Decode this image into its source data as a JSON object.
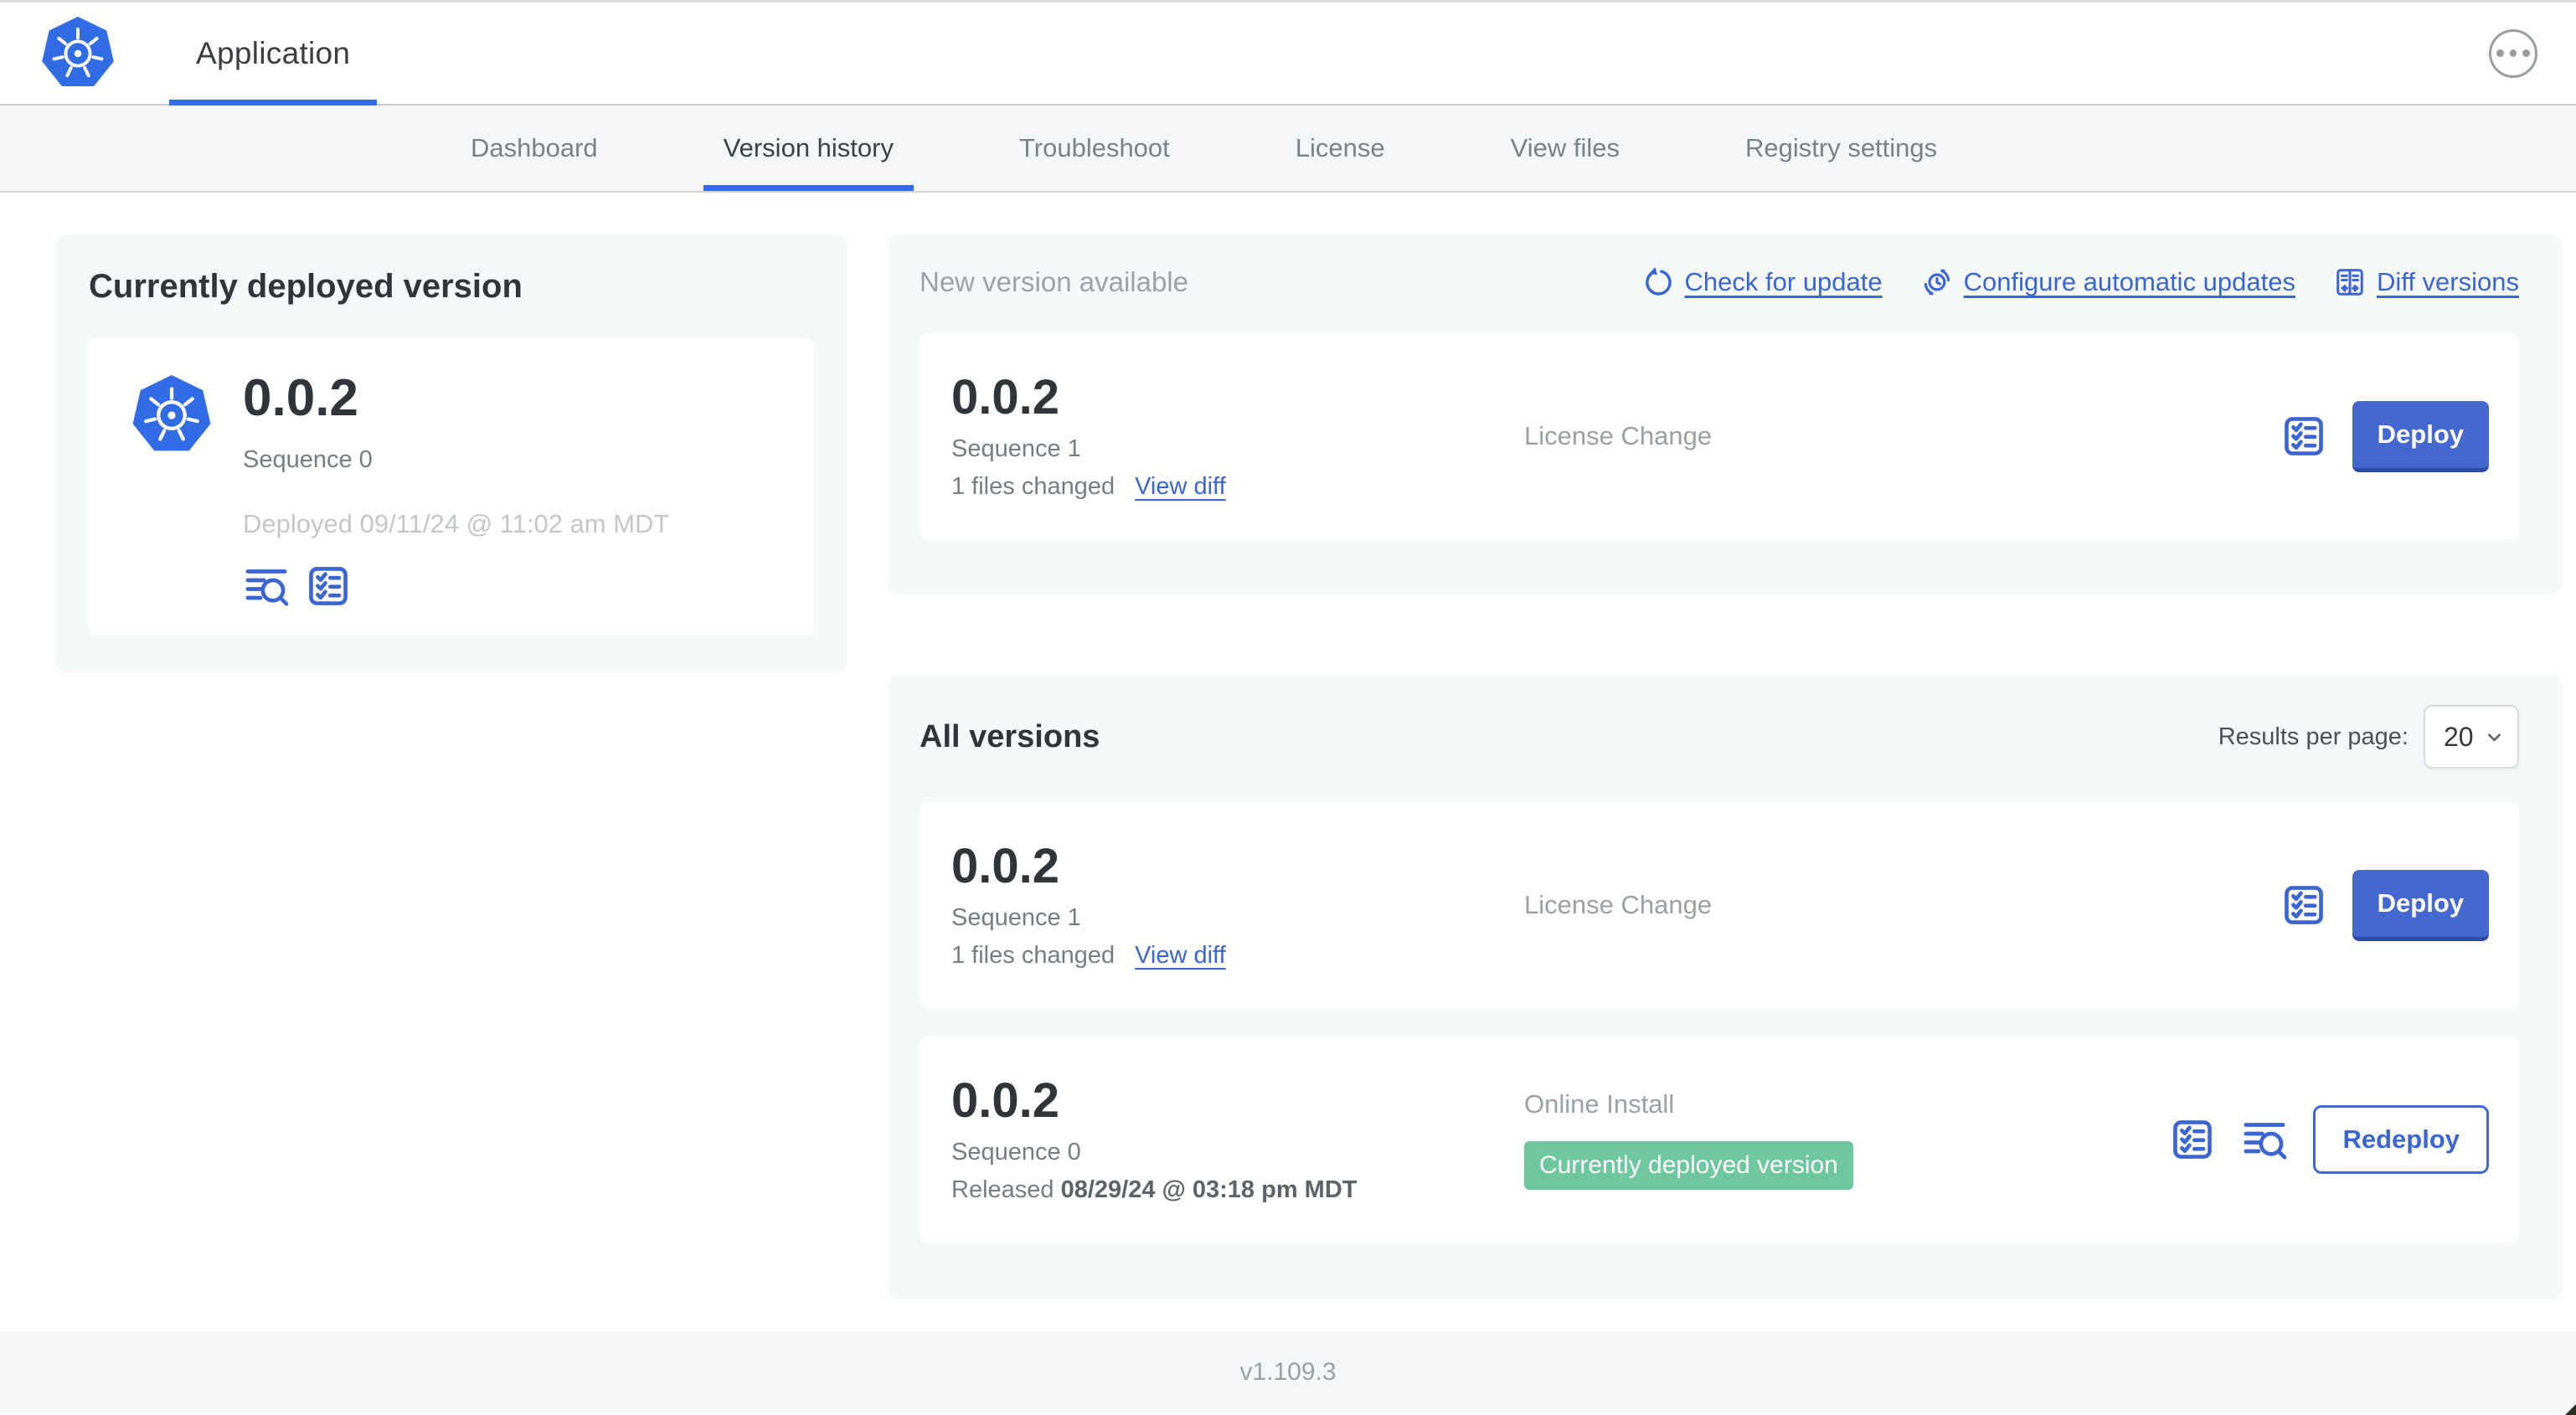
{
  "topbar": {
    "app_title": "Application"
  },
  "nav": {
    "active": "Version history",
    "tabs": [
      {
        "label": "Dashboard"
      },
      {
        "label": "Version history"
      },
      {
        "label": "Troubleshoot"
      },
      {
        "label": "License"
      },
      {
        "label": "View files"
      },
      {
        "label": "Registry settings"
      }
    ]
  },
  "current_version": {
    "title": "Currently deployed version",
    "version": "0.0.2",
    "sequence": "Sequence 0",
    "deployed": "Deployed 09/11/24 @ 11:02 am MDT"
  },
  "new_version": {
    "title": "New version available",
    "links": {
      "check_for_update": "Check for update",
      "configure_automatic_updates": "Configure automatic updates",
      "diff_versions": "Diff versions"
    },
    "card": {
      "version": "0.0.2",
      "sequence": "Sequence 1",
      "files_changed": "1 files changed",
      "view_diff": "View diff",
      "source": "License Change",
      "action": "Deploy"
    }
  },
  "all_versions": {
    "title": "All versions",
    "results_per_page_label": "Results per page:",
    "results_per_page": "20",
    "rows": [
      {
        "version": "0.0.2",
        "sequence": "Sequence 1",
        "files_changed": "1 files changed",
        "view_diff": "View diff",
        "source": "License Change",
        "action": "Deploy"
      },
      {
        "version": "0.0.2",
        "sequence": "Sequence 0",
        "released_prefix": "Released",
        "released_date": "08/29/24 @ 03:18 pm MDT",
        "source": "Online Install",
        "badge": "Currently deployed version",
        "action": "Redeploy"
      }
    ]
  },
  "footer": {
    "app_version": "v1.109.3"
  },
  "colors": {
    "accent": "#326de6",
    "link_blue": "#3b66d1",
    "button_blue": "#4568d0",
    "badge_green": "#6fc7a0",
    "panel_bg": "#f5f8f9"
  },
  "icons": {
    "kubernetes-logo": "blue heptagon with white ship wheel",
    "ellipsis-icon": "three dots in circle",
    "refresh-icon": "circular arrow",
    "schedule-update-icon": "clock with circular arrows",
    "diff-icon": "split document with left/right arrows",
    "release-notes-icon": "checklist in rounded square",
    "logs-icon": "text lines with magnifying glass",
    "chevron-down-icon": "down chevron"
  }
}
